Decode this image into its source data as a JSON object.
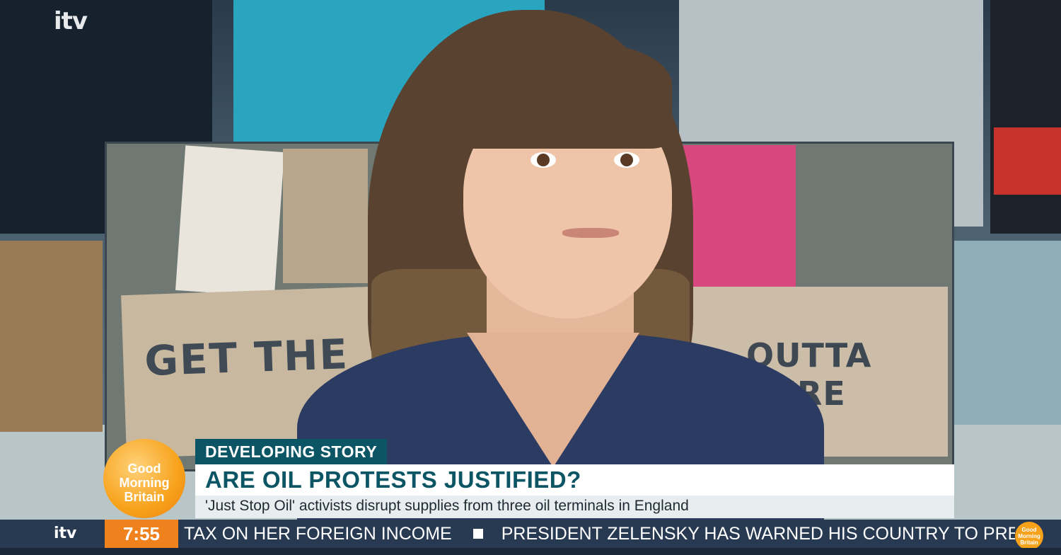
{
  "broadcaster_logo": {
    "text": "itv"
  },
  "programme_logo": {
    "lines": [
      "Good",
      "Morning",
      "Britain"
    ]
  },
  "lower_third": {
    "tag": "DEVELOPING STORY",
    "headline": "ARE OIL PROTESTS JUSTIFIED?",
    "subline": "'Just Stop Oil' activists disrupt supplies from three oil terminals in England"
  },
  "ticker": {
    "logo": "itv",
    "time": "7:55",
    "items": [
      "TAX ON HER FOREIGN INCOME",
      "PRESIDENT ZELENSKY HAS WARNED HIS COUNTRY TO PREPARE F"
    ],
    "badge_lines": [
      "Good",
      "Morning",
      "Britain"
    ]
  },
  "background_signs": {
    "left": "GET THE",
    "right": "OUTTA HERE"
  },
  "colors": {
    "tag_bg": "#0c5564",
    "headline_text": "#0c5564",
    "ticker_bg": "#283a52",
    "clock_bg": "#f0821e",
    "logo_orange": "#f7a21b"
  }
}
